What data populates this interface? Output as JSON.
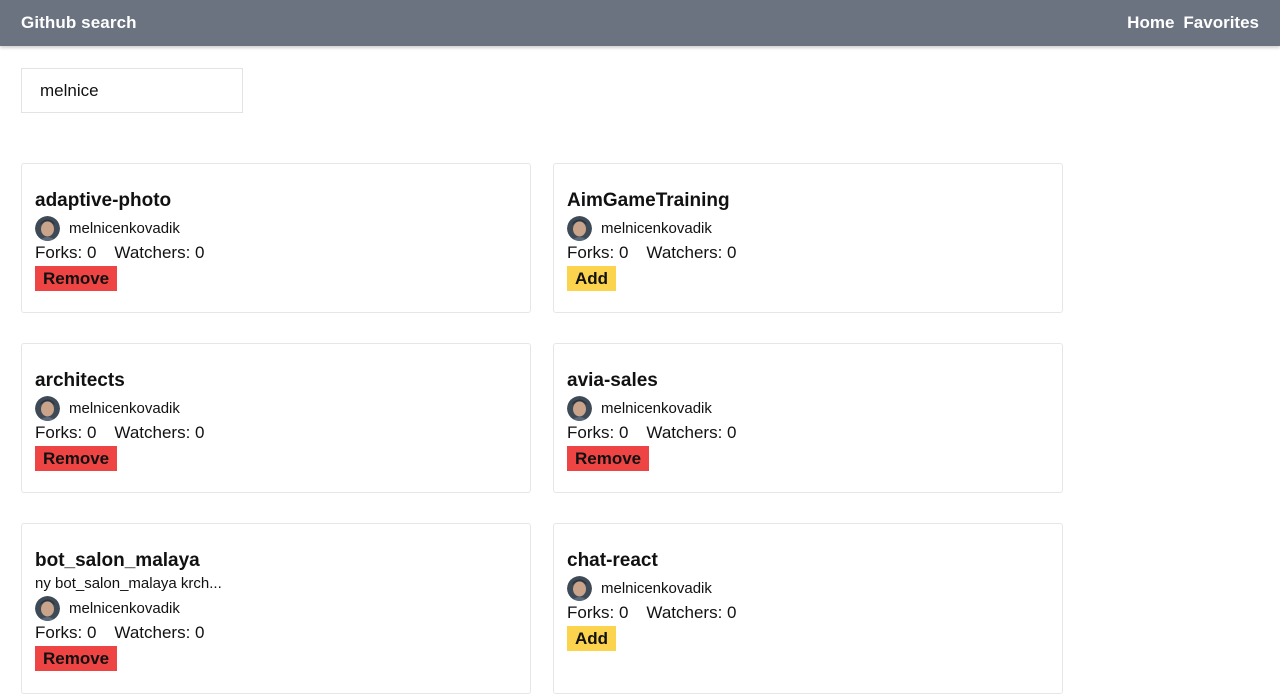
{
  "navbar": {
    "brand": "Github search",
    "links": [
      "Home",
      "Favorites"
    ]
  },
  "search": {
    "value": "melnice",
    "placeholder": ""
  },
  "repos": [
    {
      "name": "adaptive-photo",
      "description": "",
      "owner": "melnicenkovadik",
      "forks_label": "Forks: 0",
      "watchers_label": "Watchers: 0",
      "action_label": "Remove",
      "favorite": true
    },
    {
      "name": "AimGameTraining",
      "description": "",
      "owner": "melnicenkovadik",
      "forks_label": "Forks: 0",
      "watchers_label": "Watchers: 0",
      "action_label": "Add",
      "favorite": false
    },
    {
      "name": "architects",
      "description": "",
      "owner": "melnicenkovadik",
      "forks_label": "Forks: 0",
      "watchers_label": "Watchers: 0",
      "action_label": "Remove",
      "favorite": true
    },
    {
      "name": "avia-sales",
      "description": "",
      "owner": "melnicenkovadik",
      "forks_label": "Forks: 0",
      "watchers_label": "Watchers: 0",
      "action_label": "Remove",
      "favorite": true
    },
    {
      "name": "bot_salon_malaya",
      "description": "ny bot_salon_malaya krch...",
      "owner": "melnicenkovadik",
      "forks_label": "Forks: 0",
      "watchers_label": "Watchers: 0",
      "action_label": "Remove",
      "favorite": true
    },
    {
      "name": "chat-react",
      "description": "",
      "owner": "melnicenkovadik",
      "forks_label": "Forks: 0",
      "watchers_label": "Watchers: 0",
      "action_label": "Add",
      "favorite": false
    }
  ],
  "icons": {
    "avatar": "avatar-icon"
  },
  "colors": {
    "navbar": "#6b7280",
    "remove": "#ef4444",
    "add": "#fcd34d"
  }
}
